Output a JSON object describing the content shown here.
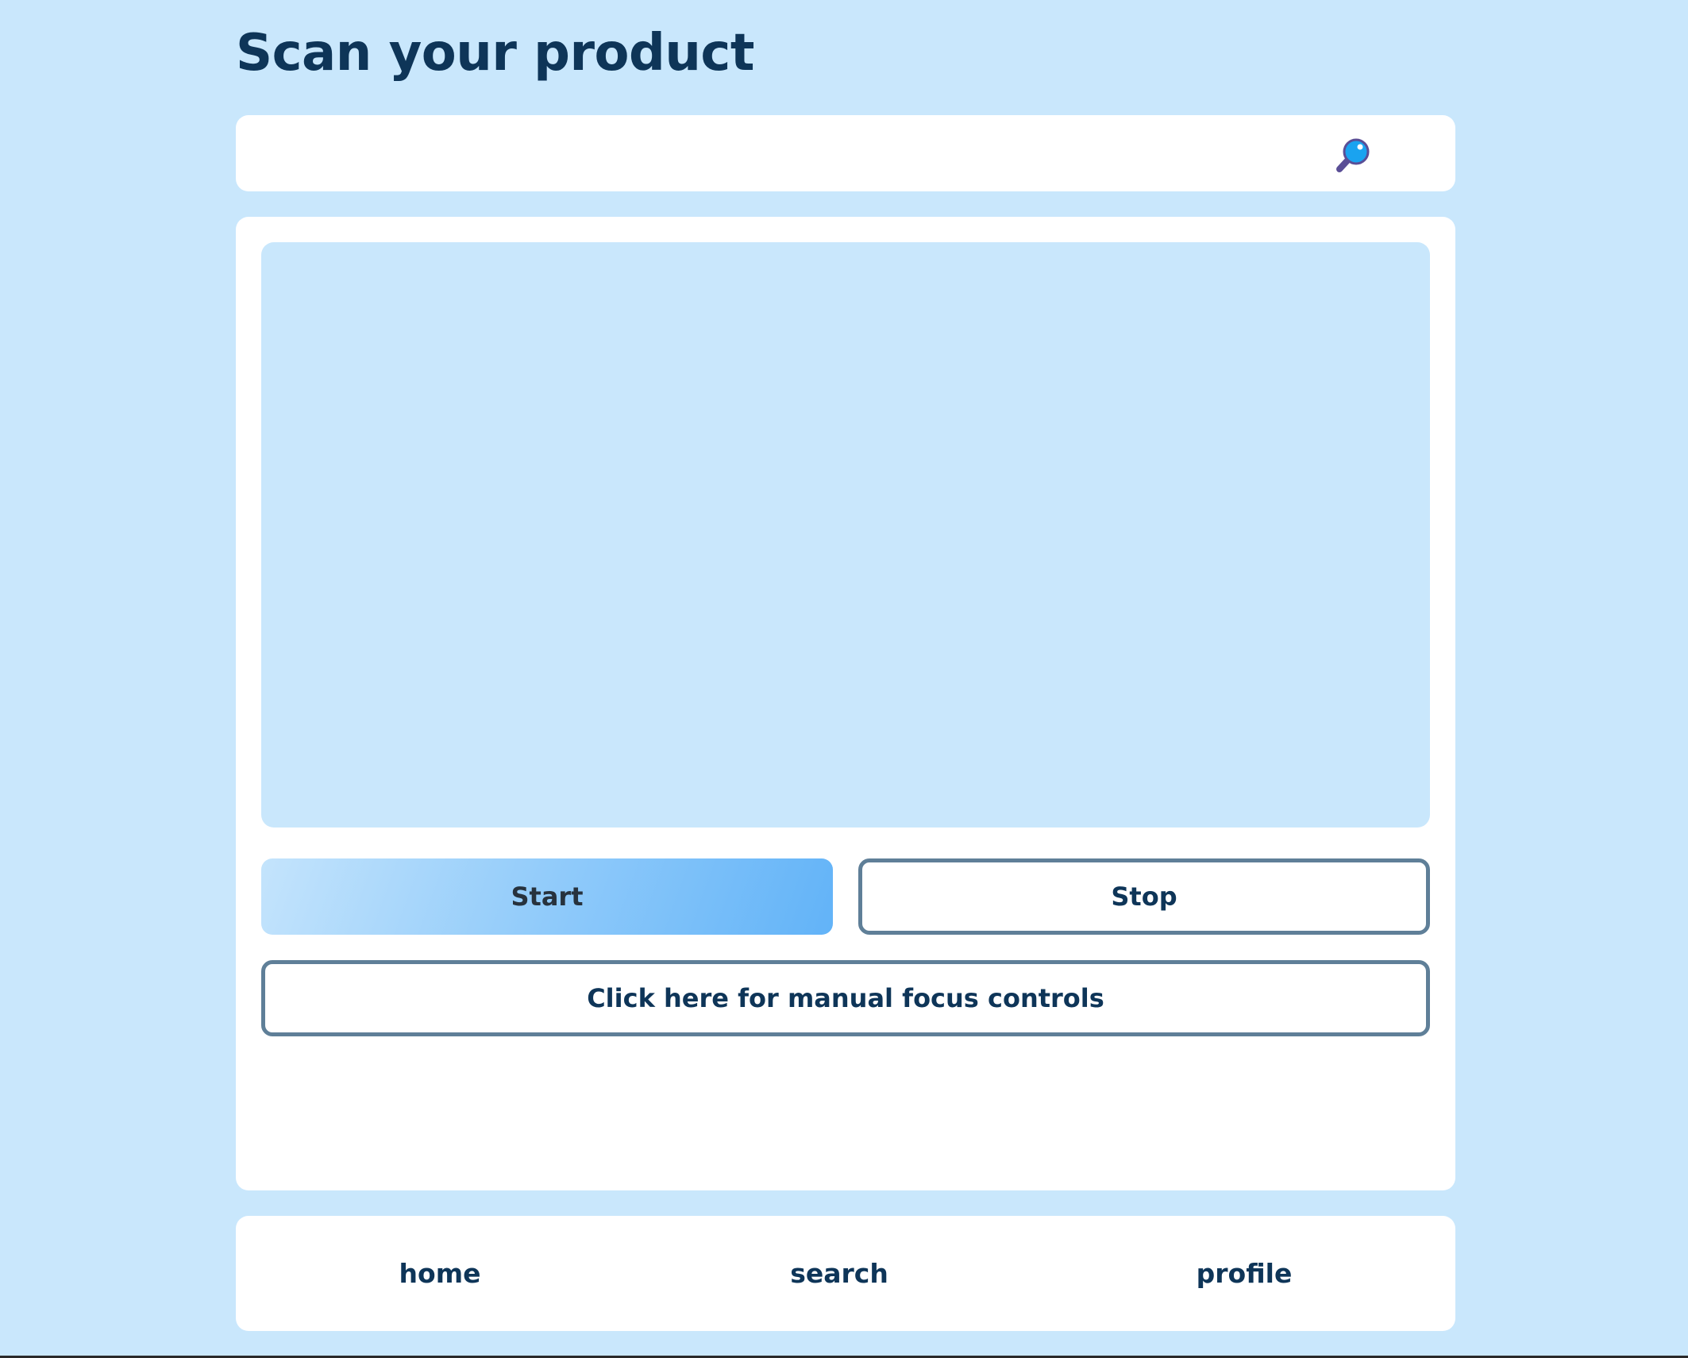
{
  "page": {
    "title": "Scan your product"
  },
  "search": {
    "value": "",
    "placeholder": "",
    "icon": "magnifying-glass-icon"
  },
  "scanner": {
    "start_label": "Start",
    "stop_label": "Stop",
    "focus_label": "Click here for manual focus controls"
  },
  "nav": {
    "items": [
      {
        "label": "home"
      },
      {
        "label": "search"
      },
      {
        "label": "profile"
      }
    ]
  },
  "colors": {
    "background": "#c9e7fc",
    "card": "#ffffff",
    "text": "#0e3558",
    "button_border": "#5f7f98",
    "start_gradient_from": "#c4e4fc",
    "start_gradient_to": "#62b3f8",
    "icon_lens": "#1aa3f0",
    "icon_handle": "#5a4e96"
  }
}
